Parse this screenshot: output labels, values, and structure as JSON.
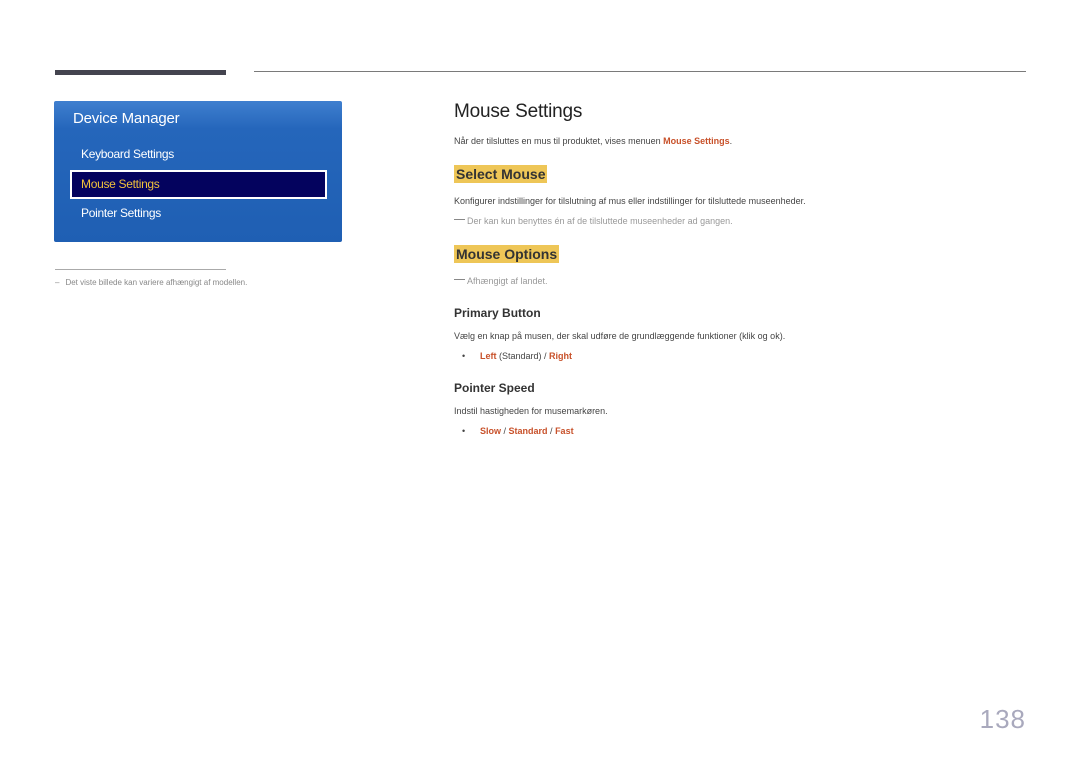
{
  "sidebar": {
    "title": "Device Manager",
    "items": [
      {
        "label": "Keyboard Settings",
        "selected": false
      },
      {
        "label": "Mouse Settings",
        "selected": true
      },
      {
        "label": "Pointer Settings",
        "selected": false
      }
    ],
    "footnote": {
      "dash": "–",
      "text": "Det viste billede kan variere afhængigt af modellen."
    }
  },
  "main": {
    "title": "Mouse Settings",
    "intro": {
      "text": "Når der tilsluttes en mus til produktet, vises menuen ",
      "link": "Mouse Settings",
      "end": "."
    },
    "select_mouse": {
      "heading": "Select Mouse",
      "description": "Konfigurer indstillinger for tilslutning af mus eller indstillinger for tilsluttede museenheder.",
      "note": "Der kan kun benyttes én af de tilsluttede museenheder ad gangen."
    },
    "mouse_options": {
      "heading": "Mouse Options",
      "note": "Afhængigt af landet.",
      "primary_button": {
        "heading": "Primary Button",
        "description": "Vælg en knap på musen, der skal udføre de grundlæggende funktioner (klik og ok).",
        "bullet": "•",
        "opt1": "Left",
        "opt1_suffix": " (Standard) / ",
        "opt2": "Right"
      },
      "pointer_speed": {
        "heading": "Pointer Speed",
        "description": "Indstil hastigheden for musemarkøren.",
        "bullet": "•",
        "opt1": "Slow",
        "sep1": " / ",
        "opt2": "Standard",
        "sep2": " / ",
        "opt3": "Fast"
      }
    }
  },
  "page_number": "138",
  "colors": {
    "accent": "#c8512a",
    "highlight": "#eec657",
    "panel_blue": "#1f5fb3",
    "selected_bg": "#04035e",
    "selected_text": "#f0c23c"
  }
}
